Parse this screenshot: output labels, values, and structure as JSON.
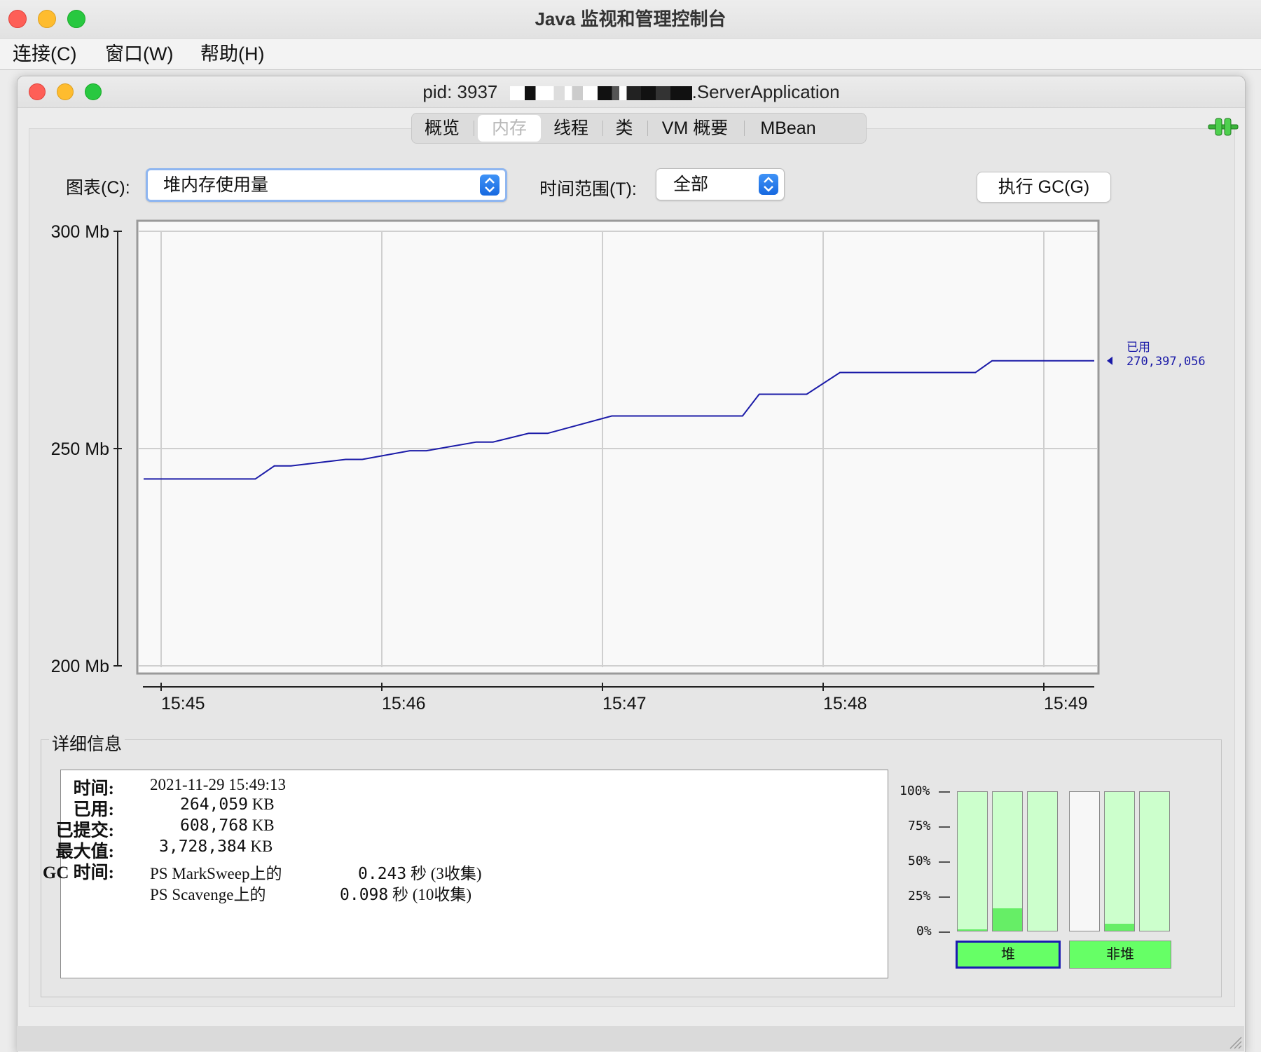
{
  "outer_window": {
    "title": "Java 监视和管理控制台"
  },
  "menubar": {
    "items": [
      "连接(C)",
      "窗口(W)",
      "帮助(H)"
    ]
  },
  "inner_window": {
    "title_prefix": "pid: 3937",
    "title_suffix": ".ServerApplication"
  },
  "tabs": {
    "items": [
      "概览",
      "内存",
      "线程",
      "类",
      "VM 概要",
      "MBean"
    ],
    "selected": "内存"
  },
  "toolbar": {
    "chart_label": "图表(C):",
    "chart_value": "堆内存使用量",
    "time_label": "时间范围(T):",
    "time_value": "全部",
    "gc_button": "执行 GC(G)"
  },
  "chart_data": {
    "type": "line",
    "y_ticks": [
      "300 Mb",
      "250 Mb",
      "200 Mb"
    ],
    "x_ticks": [
      "15:45",
      "15:46",
      "15:47",
      "15:48",
      "15:49"
    ],
    "ylim_mb": [
      200,
      300
    ],
    "series": [
      {
        "name": "已用",
        "color": "#1b1ba8",
        "x_minutes": [
          0,
          0.47,
          0.55,
          0.62,
          0.85,
          0.92,
          1.12,
          1.19,
          1.4,
          1.47,
          1.62,
          1.7,
          1.97,
          2.52,
          2.59,
          2.79,
          2.93,
          3.5,
          3.57,
          4.0
        ],
        "values_mb": [
          243,
          243,
          246,
          246,
          247.5,
          247.5,
          249.5,
          249.5,
          251.5,
          251.5,
          253.5,
          253.5,
          257.5,
          257.5,
          262.5,
          262.5,
          267.5,
          267.5,
          270.2,
          270.2
        ]
      }
    ],
    "legend": {
      "label": "已用",
      "value": "270,397,056",
      "placement": "right"
    },
    "grid": true
  },
  "details": {
    "title": "详细信息",
    "time_key": "时间:",
    "time_value": "2021-11-29 15:49:13",
    "used_key": "已用:",
    "used_num": "264,059",
    "committed_key": "已提交:",
    "committed_num": "608,768",
    "max_key": "最大值:",
    "max_num": "3,728,384",
    "unit": "KB",
    "gc_key": "GC 时间:",
    "gc1_name": "PS MarkSweep上的",
    "gc1_time": "0.243",
    "gc1_count": "(3收集)",
    "gc2_name": "PS Scavenge上的",
    "gc2_time": "0.098",
    "gc2_count": "(10收集)",
    "sec": "秒"
  },
  "memory_pools": {
    "axis": [
      "100%",
      "75%",
      "50%",
      "25%",
      "0%"
    ],
    "heap_label": "堆",
    "nonheap_label": "非堆",
    "heap_fill_fractions": [
      0.01,
      0.16,
      0.0
    ],
    "nonheap_fill_fractions": [
      0.0,
      0.05,
      0.0
    ],
    "selected": "堆"
  }
}
